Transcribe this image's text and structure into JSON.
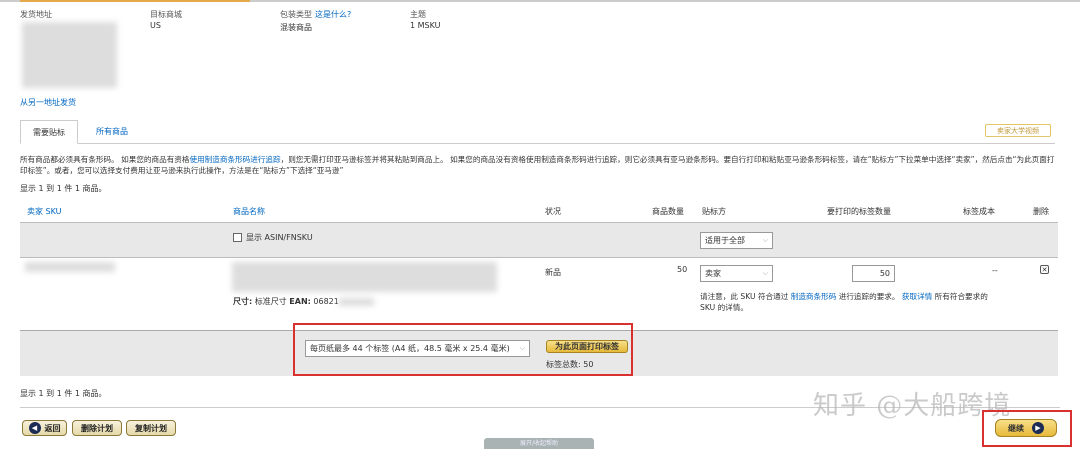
{
  "header": {
    "ship_from_label": "发货地址",
    "marketplace_label": "目标商城",
    "marketplace_value": "US",
    "packing_label": "包装类型",
    "packing_help_link": "这是什么?",
    "packing_value": "混装商品",
    "subject_label": "主题",
    "subject_value": "1 MSKU",
    "ship_other_link": "从另一地址发货"
  },
  "tabs": [
    {
      "label": "需要贴标",
      "active": true
    },
    {
      "label": "所有商品",
      "active": false
    }
  ],
  "video_button": "卖家大学视频",
  "notice": {
    "part1": "所有商品都必须具有条形码。 如果您的商品有资格",
    "link": "使用制造商条形码进行追踪",
    "part2": "，则您无需打印亚马逊标签并将其粘贴到商品上。 如果您的商品没有资格使用制造商条形码进行追踪，则它必须具有亚马逊条形码。要自行打印和粘贴亚马逊条形码标签，请在“贴标方”下拉菜单中选择“卖家”，然后点击“为此页面打印标签”。或者，您可以选择支付费用让亚马逊来执行此操作，方法是在“贴标方”下选择“亚马逊”"
  },
  "showing_text": "显示 1 到 1 件 1 商品。",
  "table": {
    "headers": {
      "sku": "卖家 SKU",
      "name": "商品名称",
      "condition": "状况",
      "qty": "商品数量",
      "prep": "贴标方",
      "labels": "要打印的标签数量",
      "cost": "标签成本",
      "delete": "删除"
    },
    "show_asin_label": "显示 ASIN/FNSKU",
    "apply_all_select": "适用于全部",
    "rows": [
      {
        "size_label": "尺寸:",
        "size_value": "标准尺寸",
        "ean_label": "EAN:",
        "ean_value": "06821",
        "condition": "新品",
        "qty": "50",
        "prep_select": "卖家",
        "labels_input": "50",
        "cost": "--",
        "note_part1": "请注意，此 SKU 符合通过 ",
        "note_link1": "制造商条形码",
        "note_part2": " 进行追踪的要求。 ",
        "note_link2": "获取详情",
        "note_part3": " 所有符合要求的 SKU 的详情。"
      }
    ]
  },
  "print": {
    "paper_select": "每页纸最多 44 个标签 (A4 纸，48.5 毫米 x 25.4 毫米)",
    "print_button": "为此页面打印标签",
    "total_label": "标签总数: 50"
  },
  "footer": {
    "back_button": "返回",
    "delete_plan_button": "删除计划",
    "copy_plan_button": "复制计划",
    "continue_button": "继续",
    "help_tab": "展开/收起帮助"
  },
  "watermark": "知乎 @大船跨境",
  "colors": {
    "accent": "#e3a94a",
    "link": "#0066c0",
    "highlight": "#d8312f"
  }
}
